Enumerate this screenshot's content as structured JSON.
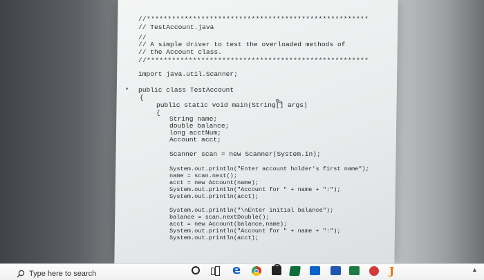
{
  "code_lines": [
    "//*****************************************************",
    "// TestAccount.java",
    "//",
    "// A simple driver to test the overloaded methods of",
    "// the Account class.",
    "//*****************************************************",
    "import java.util.Scanner;",
    "public class TestAccount",
    "{",
    "public static void main(String[] args)",
    "{",
    "String name;",
    "double balance;",
    "long acctNum;",
    "Account acct;",
    "Scanner scan = new Scanner(System.in);",
    "System.out.println(\"Enter account holder's first name\");",
    "name = scan.next();",
    "acct = new Account(name);",
    "System.out.println(\"Account for \" + name + \":\");",
    "System.out.println(acct);",
    "System.out.println(\"\\nEnter initial balance\");",
    "balance = scan.nextDouble();",
    "acct = new Account(balance,name);",
    "System.out.println(\"Account for \" + name + \":\");",
    "System.out.println(acct);"
  ],
  "taskbar": {
    "search_placeholder": "Type here to search",
    "icons": [
      "search-icon",
      "cortana-icon",
      "task-view-icon",
      "edge-icon",
      "chrome-icon",
      "store-icon",
      "netbeans-icon",
      "outlook-icon",
      "word-icon",
      "excel-icon",
      "pinned-app-icon",
      "java-icon"
    ]
  },
  "colors": {
    "paper": "#eeeff0",
    "code_text": "#2a2a2e",
    "taskbar": "#f3f3f3",
    "edge": "#1560c7",
    "java": "#e17000"
  }
}
